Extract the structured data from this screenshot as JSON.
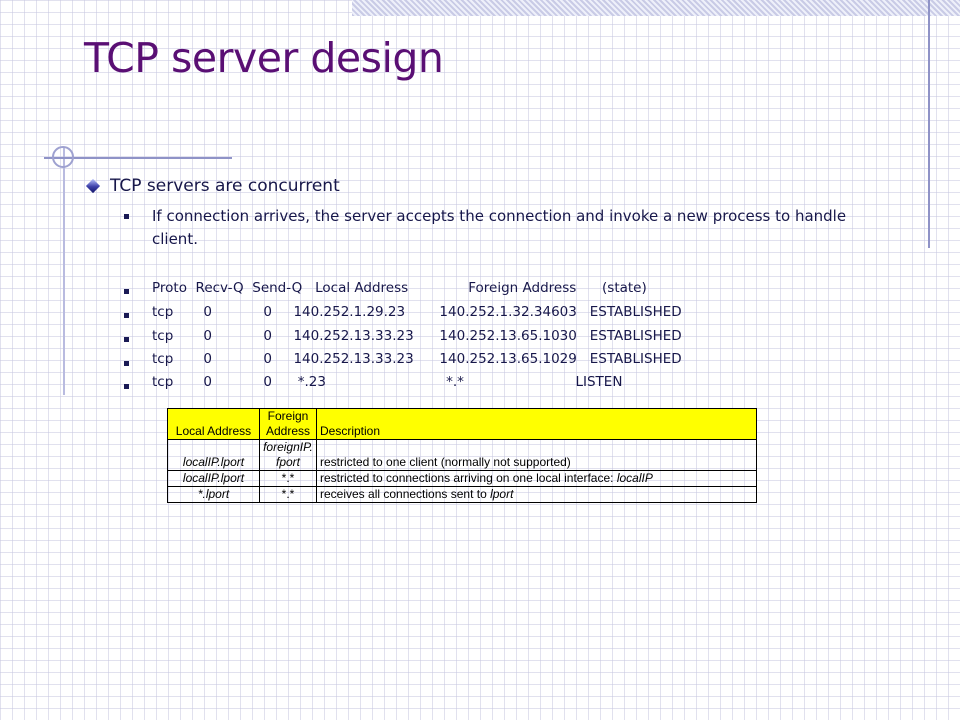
{
  "slide": {
    "title": "TCP server design",
    "bullet_main": "TCP servers are concurrent",
    "sub_bullet": "If connection arrives, the server accepts the connection and invoke a new process to handle client.",
    "netstat_lines": [
      "Proto  Recv-Q  Send-Q   Local Address              Foreign Address      (state)",
      "tcp       0            0     140.252.1.29.23        140.252.1.32.34603   ESTABLISHED",
      "tcp       0            0     140.252.13.33.23      140.252.13.65.1030   ESTABLISHED",
      "tcp       0            0     140.252.13.33.23      140.252.13.65.1029   ESTABLISHED",
      "tcp       0            0      *.23                            *.*                          LISTEN"
    ]
  },
  "table": {
    "headers": {
      "local": "Local Address",
      "foreign_line1": "Foreign",
      "foreign_line2": "Address",
      "description": "Description"
    },
    "rows": [
      {
        "local": "localIP.lport",
        "foreign_line1": "foreignIP.",
        "foreign_line2": "fport",
        "description": "restricted to one client (normally not supported)"
      },
      {
        "local": "localIP.lport",
        "foreign": "*.*",
        "description_prefix": "restricted to connections arriving on one local interface: ",
        "description_italic": "localIP"
      },
      {
        "local": "*.lport",
        "foreign": "*.*",
        "description_prefix": "receives all connections sent to ",
        "description_italic": "lport"
      }
    ]
  },
  "colors": {
    "title": "#5a0f74",
    "text": "#17174a",
    "header_fill": "#ffff00",
    "accent_line": "#8f93c7"
  }
}
